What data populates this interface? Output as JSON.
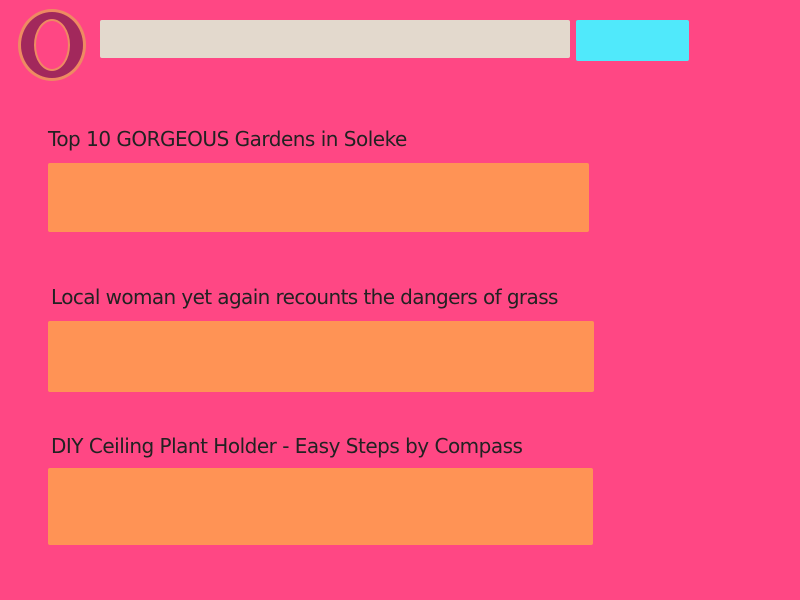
{
  "header": {
    "logo_icon": "letter-o-logo-icon",
    "search": {
      "value": "",
      "placeholder": ""
    },
    "search_button_label": ""
  },
  "articles": [
    {
      "title": "Top 10 GORGEOUS Gardens in Soleke"
    },
    {
      "title": "Local woman yet again recounts the dangers of grass"
    },
    {
      "title": "DIY Ceiling Plant Holder - Easy Steps by Compass"
    }
  ],
  "colors": {
    "background": "#ff4784",
    "search_bar": "#e3d9cd",
    "search_button": "#50e9fb",
    "article_box": "#ff9355",
    "logo_ring": "#ee8a62",
    "logo_fill": "#a2285c"
  }
}
